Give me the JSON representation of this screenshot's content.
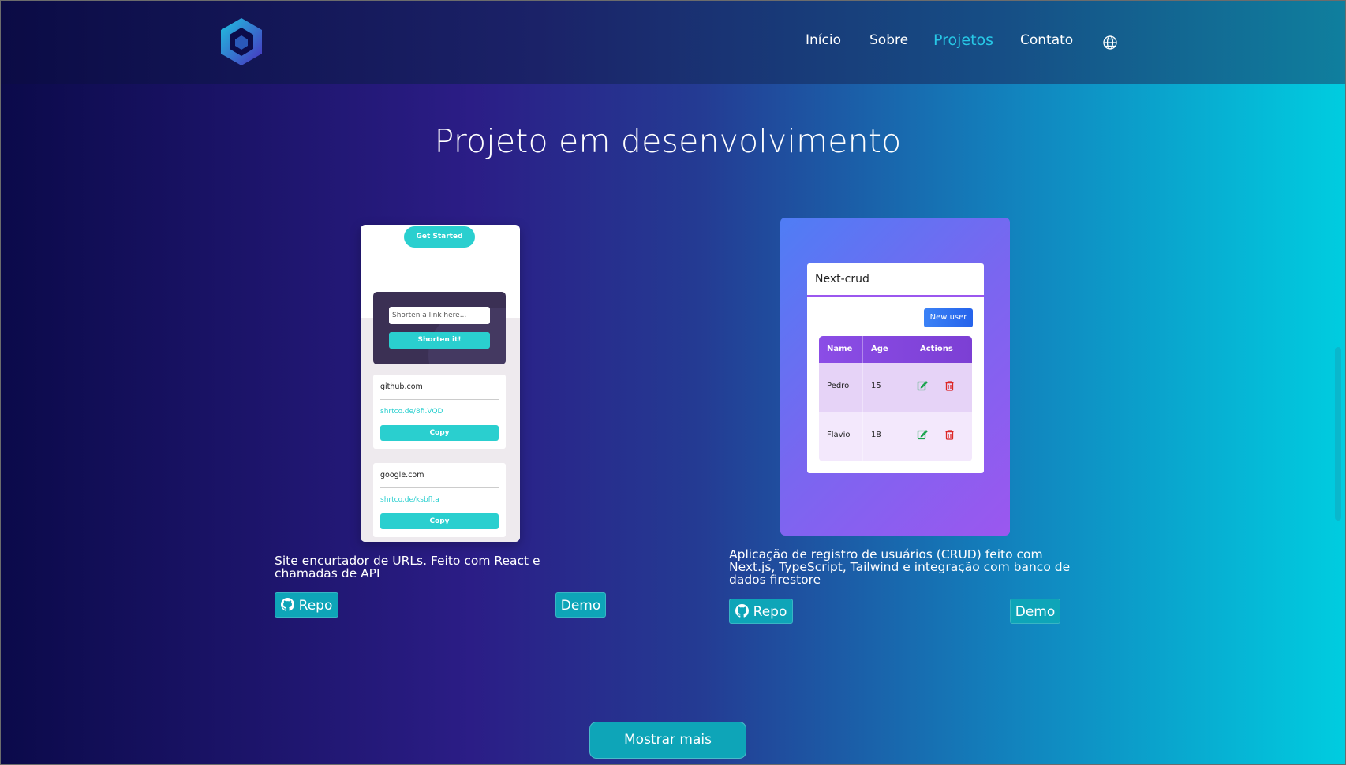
{
  "nav": {
    "items": [
      "Início",
      "Sobre",
      "Projetos",
      "Contato"
    ],
    "active": "Projetos",
    "icons": {
      "logo": "hexagon-cube-logo",
      "language": "globe-icon"
    }
  },
  "page_title": "Projeto em desenvolvimento",
  "projects": [
    {
      "description": "Site encurtador de URLs. Feito com React e chamadas de API",
      "repo_label": "Repo",
      "demo_label": "Demo",
      "preview": {
        "get_started": "Get Started",
        "input_placeholder": "Shorten a link here...",
        "shorten_button": "Shorten it!",
        "links": [
          {
            "url": "github.com",
            "short": "shrtco.de/8fi.VQD",
            "copy": "Copy"
          },
          {
            "url": "google.com",
            "short": "shrtco.de/ksbfl.a",
            "copy": "Copy"
          }
        ]
      }
    },
    {
      "description": "Aplicação de registro de usuários (CRUD) feito com Next.js, TypeScript, Tailwind e integração com banco de dados firestore",
      "repo_label": "Repo",
      "demo_label": "Demo",
      "preview": {
        "title": "Next-crud",
        "new_user": "New user",
        "columns": [
          "Name",
          "Age",
          "Actions"
        ],
        "rows": [
          {
            "name": "Pedro",
            "age": "15"
          },
          {
            "name": "Flávio",
            "age": "18"
          }
        ]
      }
    }
  ],
  "show_more": "Mostrar mais",
  "colors": {
    "accent": "#27c8e6",
    "button": "#0ea5b8",
    "teal": "#2acfcf",
    "purple": "#9b57ef"
  }
}
